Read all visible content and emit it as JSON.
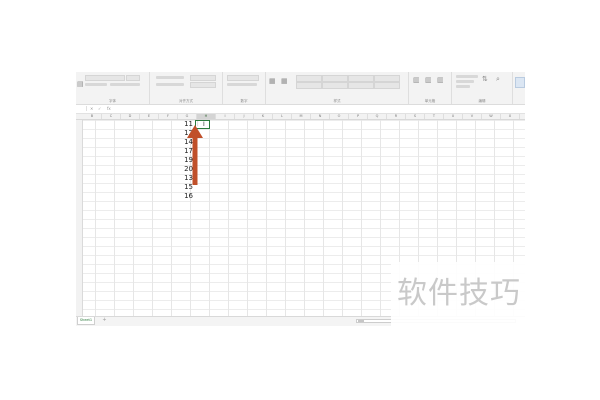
{
  "ribbon": {
    "groups": [
      {
        "label": "字体"
      },
      {
        "label": "对齐方式"
      },
      {
        "label": "数字"
      },
      {
        "label": "样式"
      },
      {
        "label": "单元格"
      },
      {
        "label": "编辑"
      }
    ]
  },
  "formula_bar": {
    "cancel_symbol": "✕",
    "enter_symbol": "✓",
    "fx_symbol": "fx",
    "value": ""
  },
  "columns": [
    "B",
    "C",
    "D",
    "E",
    "F",
    "G",
    "H",
    "I",
    "J",
    "K",
    "L",
    "M",
    "N",
    "O",
    "P",
    "Q",
    "R",
    "S",
    "T",
    "U",
    "V",
    "W",
    "X"
  ],
  "selected_column": "H",
  "cells": [
    "11",
    "12",
    "14",
    "17",
    "19",
    "20",
    "13",
    "15",
    "16"
  ],
  "active_cell": {
    "cursor": "I",
    "marker": "|"
  },
  "sheet_tabs": [
    {
      "label": "Sheet1"
    }
  ],
  "add_sheet_symbol": "+",
  "annotation": {
    "arrow_color": "#c0502a"
  },
  "watermark": {
    "text": "软件技巧"
  },
  "colors": {
    "accent": "#2c7a3d"
  }
}
